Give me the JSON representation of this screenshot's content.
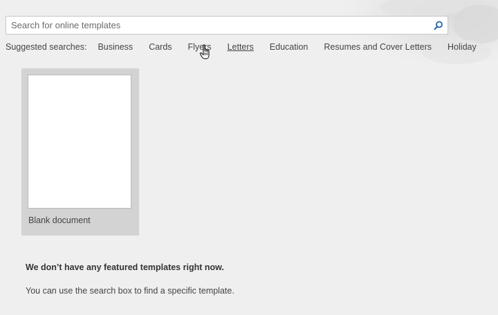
{
  "search": {
    "placeholder": "Search for online templates",
    "value": "",
    "button_icon": "search-icon"
  },
  "suggested": {
    "label": "Suggested searches:",
    "items": [
      {
        "label": "Business"
      },
      {
        "label": "Cards"
      },
      {
        "label": "Flyers"
      },
      {
        "label": "Letters"
      },
      {
        "label": "Education"
      },
      {
        "label": "Resumes and Cover Letters"
      },
      {
        "label": "Holiday"
      }
    ]
  },
  "templates": [
    {
      "name": "Blank document"
    }
  ],
  "notice": {
    "title": "We don’t have any featured templates right now.",
    "text": "You can use the search box to find a specific template."
  },
  "colors": {
    "background": "#efefef",
    "tile": "#d3d3d3",
    "search_icon": "#1e5fa8"
  },
  "cursor": "hand-pointer-icon"
}
